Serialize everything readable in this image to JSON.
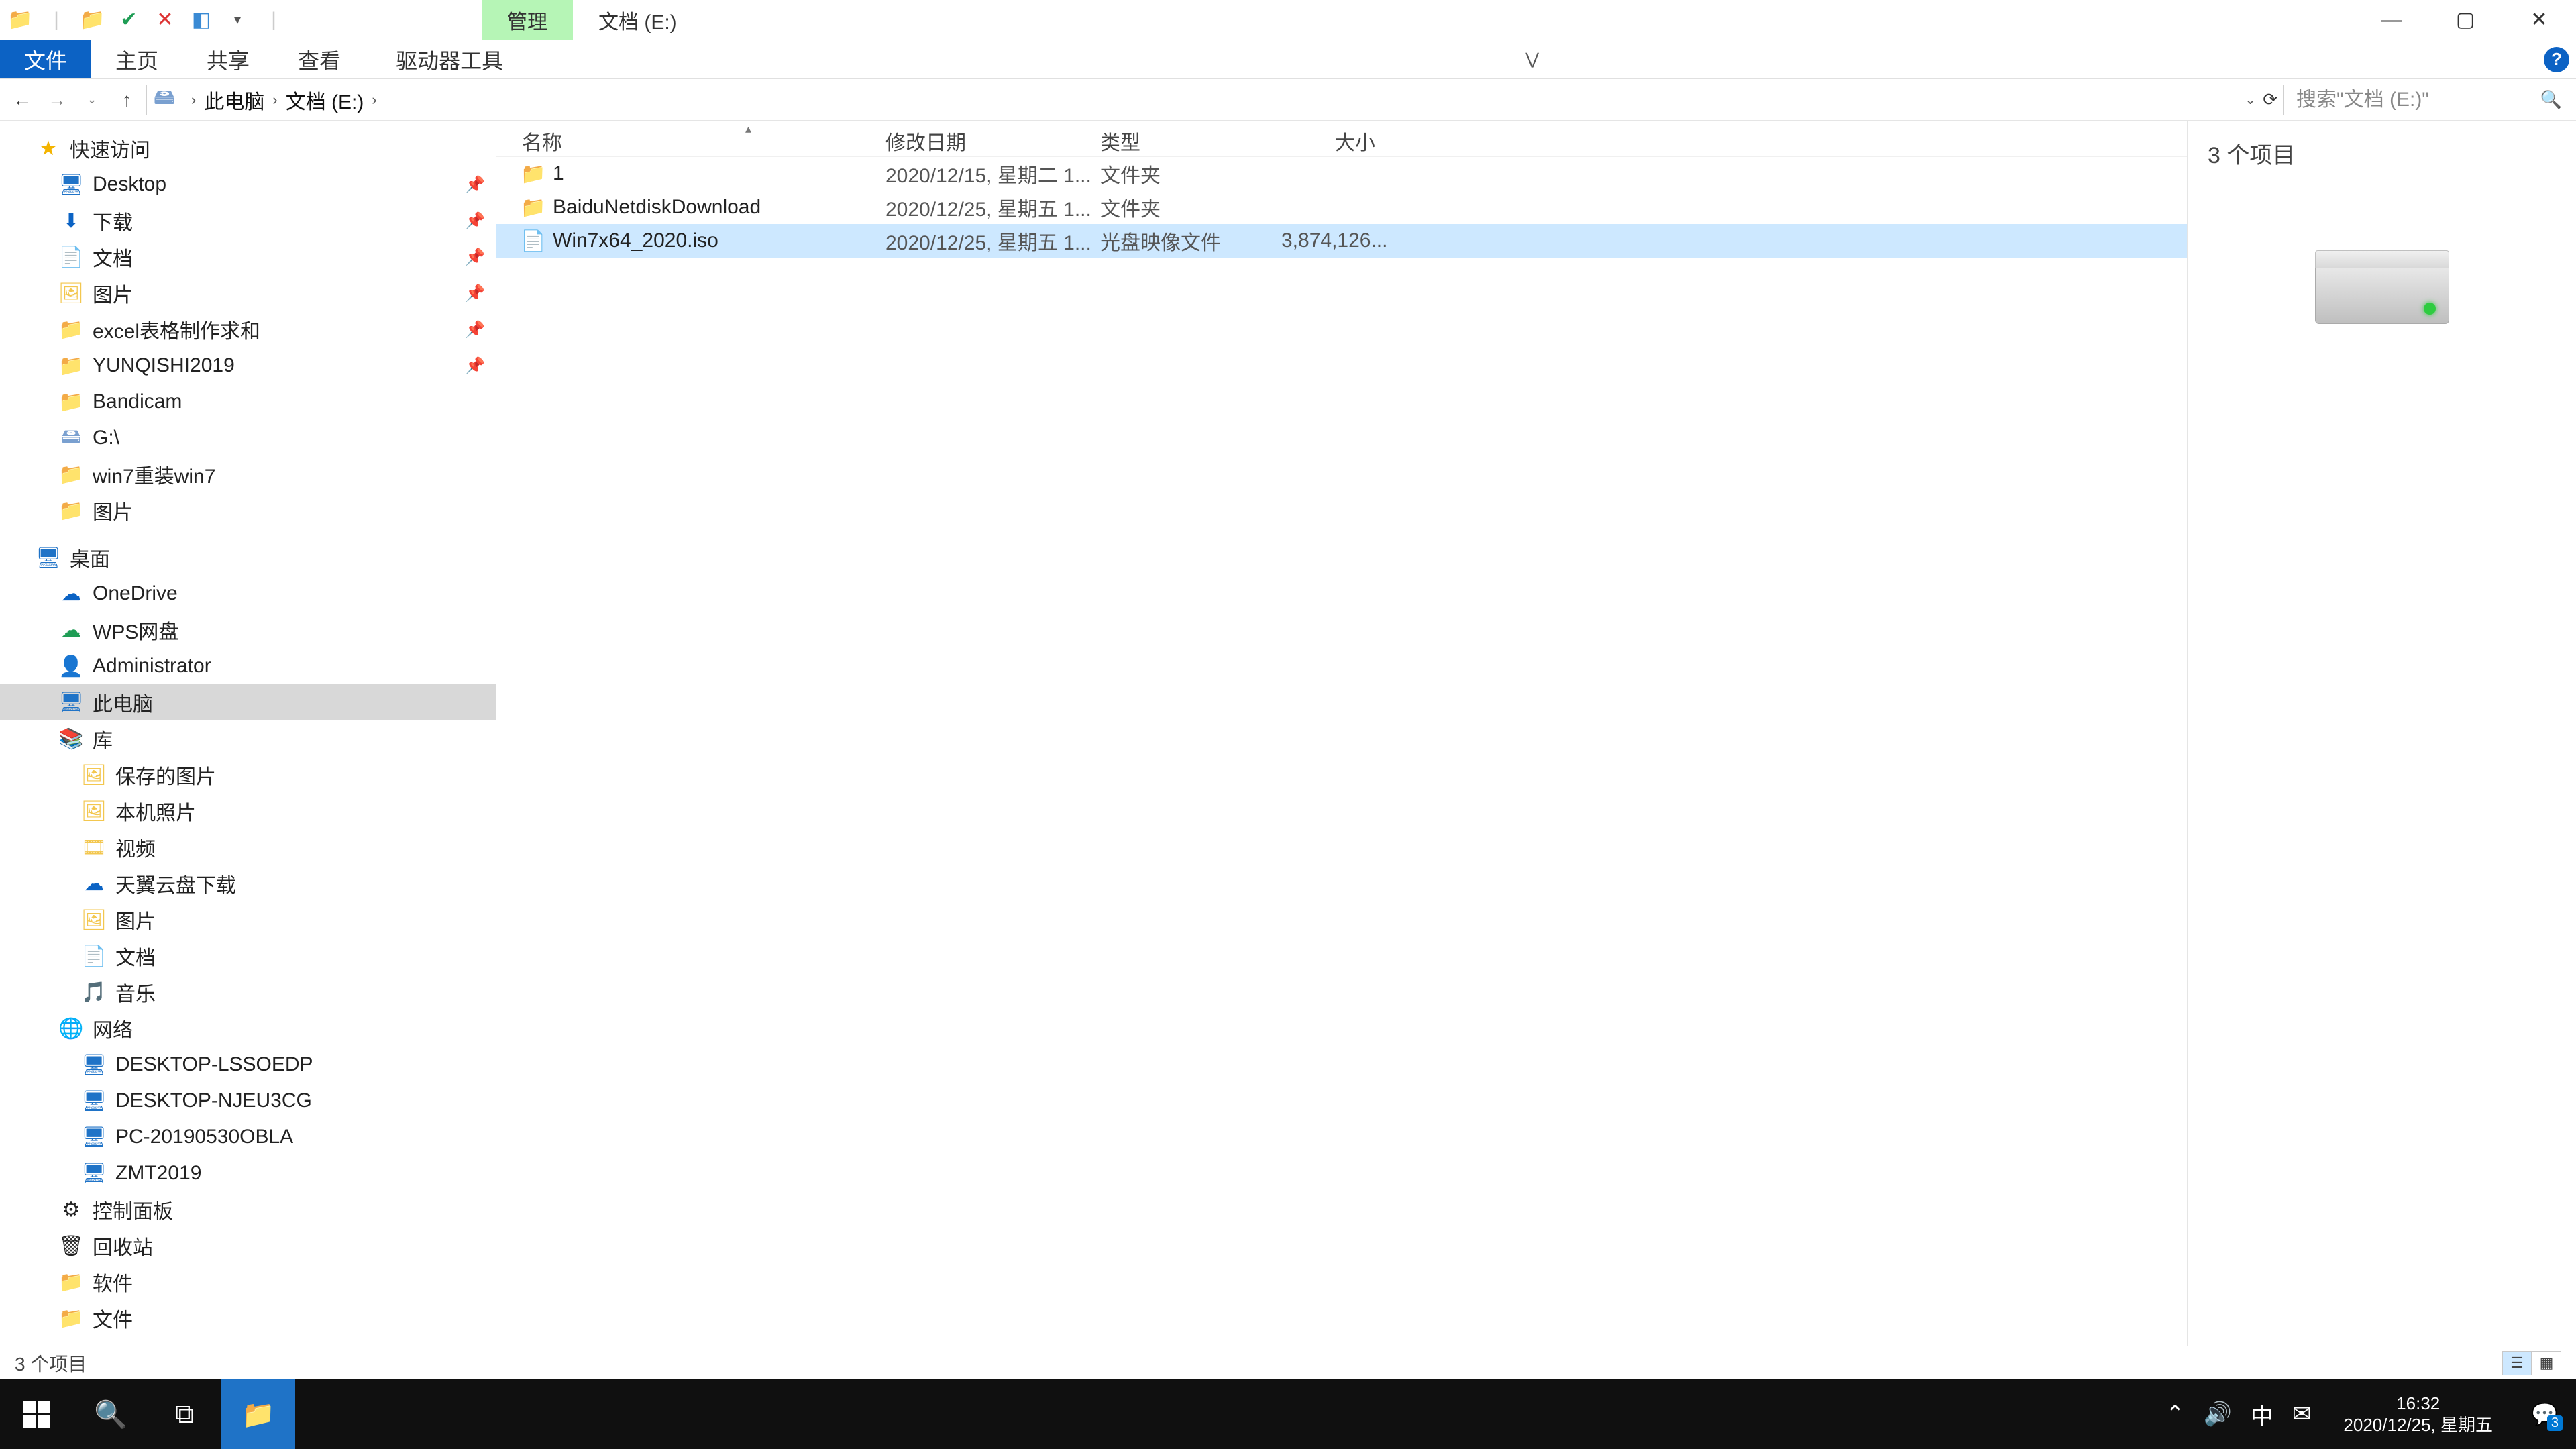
{
  "titlebar": {
    "context_tab": "管理",
    "path_tab": "文档 (E:)"
  },
  "ribbon": {
    "file": "文件",
    "home": "主页",
    "share": "共享",
    "view": "查看",
    "drive_tools": "驱动器工具"
  },
  "address": {
    "crumb1": "此电脑",
    "crumb2": "文档 (E:)"
  },
  "search": {
    "placeholder": "搜索\"文档 (E:)\""
  },
  "nav": {
    "quick_access": "快速访问",
    "desktop": "Desktop",
    "downloads": "下载",
    "documents": "文档",
    "pictures": "图片",
    "excel_template": "excel表格制作求和",
    "yunqishi": "YUNQISHI2019",
    "bandicam": "Bandicam",
    "gdrive": "G:\\",
    "win7reinstall": "win7重装win7",
    "pictures2": "图片",
    "desktop_root": "桌面",
    "onedrive": "OneDrive",
    "wps": "WPS网盘",
    "administrator": "Administrator",
    "this_pc": "此电脑",
    "library": "库",
    "saved_pictures": "保存的图片",
    "local_photos": "本机照片",
    "video": "视频",
    "tianyi": "天翼云盘下载",
    "pictures3": "图片",
    "documents2": "文档",
    "music": "音乐",
    "network": "网络",
    "pc1": "DESKTOP-LSSOEDP",
    "pc2": "DESKTOP-NJEU3CG",
    "pc3": "PC-20190530OBLA",
    "pc4": "ZMT2019",
    "control_panel": "控制面板",
    "recycle": "回收站",
    "software": "软件",
    "files": "文件"
  },
  "columns": {
    "name": "名称",
    "date": "修改日期",
    "type": "类型",
    "size": "大小"
  },
  "rows": [
    {
      "name": "1",
      "date": "2020/12/15, 星期二 1...",
      "type": "文件夹",
      "size": "",
      "icon": "folder",
      "selected": false
    },
    {
      "name": "BaiduNetdiskDownload",
      "date": "2020/12/25, 星期五 1...",
      "type": "文件夹",
      "size": "",
      "icon": "folder",
      "selected": false
    },
    {
      "name": "Win7x64_2020.iso",
      "date": "2020/12/25, 星期五 1...",
      "type": "光盘映像文件",
      "size": "3,874,126...",
      "icon": "file",
      "selected": true
    }
  ],
  "preview": {
    "count_label": "3 个项目"
  },
  "status": {
    "items": "3 个项目"
  },
  "tray": {
    "ime": "中",
    "time": "16:32",
    "date": "2020/12/25, 星期五",
    "action_badge": "3"
  }
}
